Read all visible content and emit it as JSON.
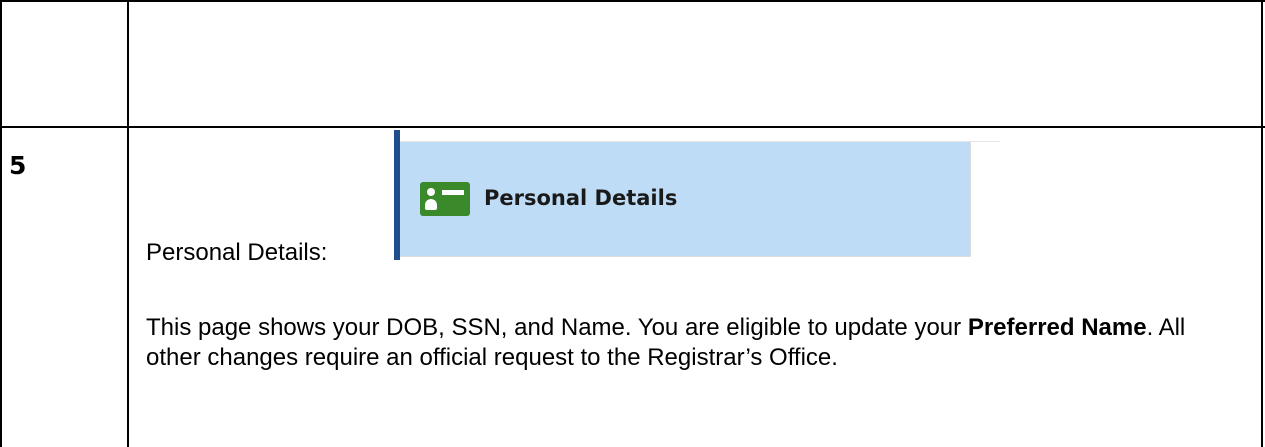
{
  "row": {
    "step_number": "5",
    "inline_label": "Personal Details:",
    "screenshot": {
      "title": "Personal Details",
      "icon": "id-card-icon",
      "accent_color": "#1f4e8c",
      "background_color": "#bfdcf7",
      "icon_color": "#3a8a2c"
    },
    "paragraph": {
      "part1": "This page shows your DOB, SSN, and Name. You are eligible to update your ",
      "bold": "Preferred Name",
      "part2": ". All other changes require an official request to the Registrar’s Office."
    }
  }
}
